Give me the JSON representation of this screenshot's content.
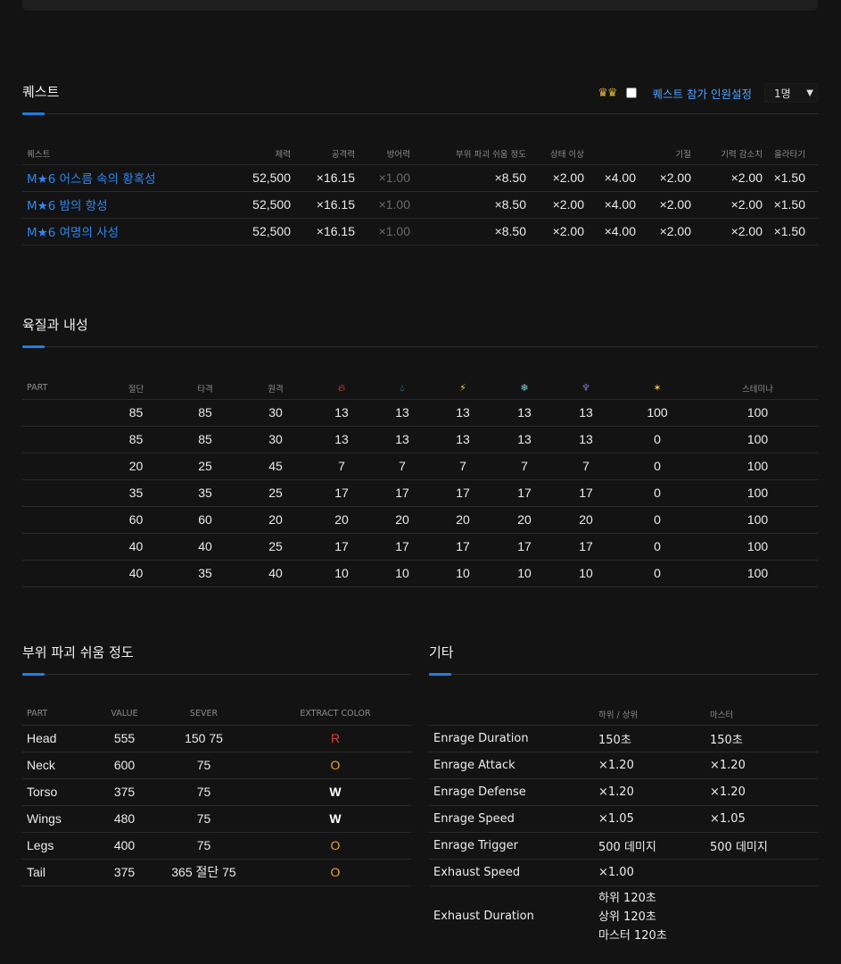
{
  "quest_section": {
    "title": "퀘스트",
    "crowns": "♛♛",
    "party_label": "퀘스트 참가 인원설정",
    "party_select": "1명",
    "headers": [
      "퀘스트",
      "체력",
      "공격력",
      "방어력",
      "부위 파괴 쉬움 정도",
      "상태 이상",
      "",
      "기절",
      "기력 감소치",
      "올라타기"
    ],
    "rows": [
      {
        "name": "M★6 어스름 속의 황혹성",
        "hp": "52,500",
        "atk": "×16.15",
        "def": "×1.00",
        "break": "×8.50",
        "status1": "×2.00",
        "status2": "×4.00",
        "stun": "×2.00",
        "exhaust": "×2.00",
        "mount": "×1.50"
      },
      {
        "name": "M★6 밤의 항성",
        "hp": "52,500",
        "atk": "×16.15",
        "def": "×1.00",
        "break": "×8.50",
        "status1": "×2.00",
        "status2": "×4.00",
        "stun": "×2.00",
        "exhaust": "×2.00",
        "mount": "×1.50"
      },
      {
        "name": "M★6 여명의 사성",
        "hp": "52,500",
        "atk": "×16.15",
        "def": "×1.00",
        "break": "×8.50",
        "status1": "×2.00",
        "status2": "×4.00",
        "stun": "×2.00",
        "exhaust": "×2.00",
        "mount": "×1.50"
      }
    ]
  },
  "hitzone_section": {
    "title": "육질과 내성",
    "headers": {
      "part": "PART",
      "cut": "절단",
      "blunt": "타격",
      "ranged": "원격",
      "stamina": "스테미나"
    },
    "element_icons": [
      "fire-icon",
      "water-icon",
      "thunder-icon",
      "ice-icon",
      "dragon-icon",
      "stun-icon"
    ],
    "rows": [
      [
        "85",
        "85",
        "30",
        "13",
        "13",
        "13",
        "13",
        "13",
        "100",
        "100"
      ],
      [
        "85",
        "85",
        "30",
        "13",
        "13",
        "13",
        "13",
        "13",
        "0",
        "100"
      ],
      [
        "20",
        "25",
        "45",
        "7",
        "7",
        "7",
        "7",
        "7",
        "0",
        "100"
      ],
      [
        "35",
        "35",
        "25",
        "17",
        "17",
        "17",
        "17",
        "17",
        "0",
        "100"
      ],
      [
        "60",
        "60",
        "20",
        "20",
        "20",
        "20",
        "20",
        "20",
        "0",
        "100"
      ],
      [
        "40",
        "40",
        "25",
        "17",
        "17",
        "17",
        "17",
        "17",
        "0",
        "100"
      ],
      [
        "40",
        "35",
        "40",
        "10",
        "10",
        "10",
        "10",
        "10",
        "0",
        "100"
      ]
    ]
  },
  "break_section": {
    "title": "부위 파괴 쉬움 정도",
    "headers": [
      "PART",
      "VALUE",
      "SEVER",
      "EXTRACT COLOR"
    ],
    "rows": [
      {
        "part": "Head",
        "value": "555",
        "sever": "150 75",
        "color": "R"
      },
      {
        "part": "Neck",
        "value": "600",
        "sever": "75",
        "color": "O"
      },
      {
        "part": "Torso",
        "value": "375",
        "sever": "75",
        "color": "W"
      },
      {
        "part": "Wings",
        "value": "480",
        "sever": "75",
        "color": "W"
      },
      {
        "part": "Legs",
        "value": "400",
        "sever": "75",
        "color": "O"
      },
      {
        "part": "Tail",
        "value": "375",
        "sever": "365 절단 75",
        "color": "O"
      }
    ]
  },
  "misc_section": {
    "title": "기타",
    "headers": [
      "",
      "하위 / 상위",
      "마스터"
    ],
    "rows": [
      {
        "label": "Enrage Duration",
        "low": "150초",
        "master": "150초"
      },
      {
        "label": "Enrage Attack",
        "low": "×1.20",
        "master": "×1.20"
      },
      {
        "label": "Enrage Defense",
        "low": "×1.20",
        "master": "×1.20"
      },
      {
        "label": "Enrage Speed",
        "low": "×1.05",
        "master": "×1.05"
      },
      {
        "label": "Enrage Trigger",
        "low": "500 데미지",
        "master": "500 데미지"
      },
      {
        "label": "Exhaust Speed",
        "low": "×1.00",
        "master": ""
      }
    ],
    "exhaust_duration": {
      "label": "Exhaust Duration",
      "lines": [
        "하위 120초",
        "상위 120초",
        "마스터 120초"
      ]
    }
  }
}
